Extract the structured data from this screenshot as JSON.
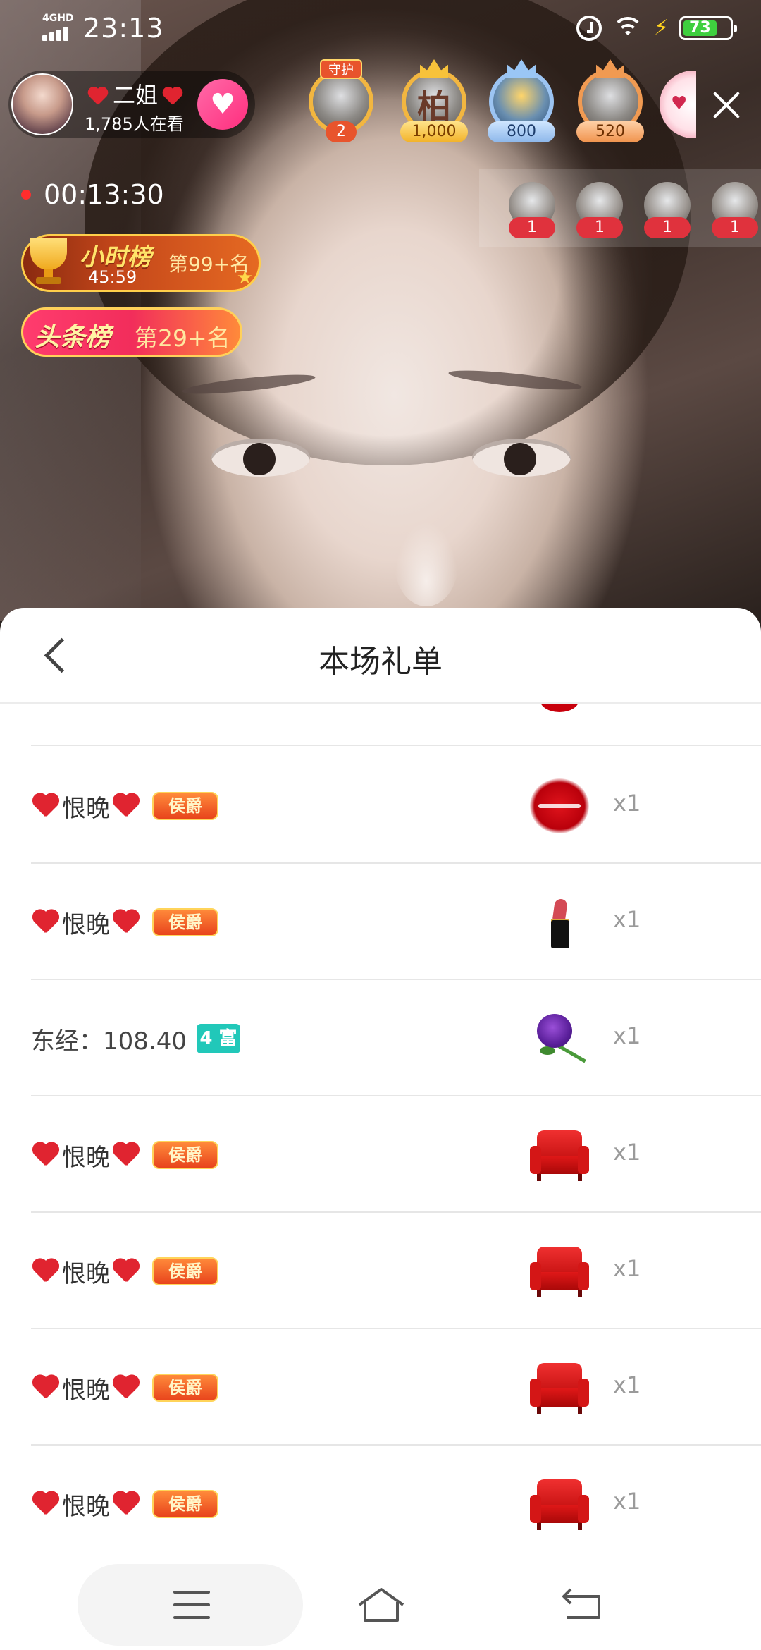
{
  "status_bar": {
    "network": "4GHD",
    "time": "23:13",
    "battery": "73",
    "icons": [
      "signal-icon",
      "alarm-icon",
      "wifi-icon",
      "charging-icon",
      "battery-icon"
    ]
  },
  "host": {
    "name": "二姐",
    "viewers": "1,785人在看"
  },
  "fan_badges": [
    {
      "tag": "守护",
      "value": "2",
      "style": "guard"
    },
    {
      "char": "柏",
      "value": "1,000",
      "style": "gold"
    },
    {
      "value": "800",
      "style": "silver"
    },
    {
      "value": "520",
      "style": "bronze"
    }
  ],
  "live": {
    "elapsed": "00:13:30"
  },
  "viewer_avatars": [
    {
      "count": "1"
    },
    {
      "count": "1"
    },
    {
      "count": "1"
    },
    {
      "count": "1"
    }
  ],
  "rank_hour": {
    "title": "小时榜",
    "countdown": "45:59",
    "rank": "第99+名"
  },
  "rank_headline": {
    "title": "头条榜",
    "rank": "第29+名"
  },
  "sheet": {
    "title": "本场礼单"
  },
  "gift_rows": [
    {
      "user": "恨晚",
      "badge": "侯爵",
      "gift_icon": "lips-icon",
      "qty": "x1"
    },
    {
      "user": "恨晚",
      "badge": "侯爵",
      "gift_icon": "lipstick-icon",
      "qty": "x1"
    },
    {
      "user": "东经：108.40",
      "wealth": "4 富",
      "gift_icon": "rose-icon",
      "qty": "x1"
    },
    {
      "user": "恨晚",
      "badge": "侯爵",
      "gift_icon": "sofa-icon",
      "qty": "x1"
    },
    {
      "user": "恨晚",
      "badge": "侯爵",
      "gift_icon": "sofa-icon",
      "qty": "x1"
    },
    {
      "user": "恨晚",
      "badge": "侯爵",
      "gift_icon": "sofa-icon",
      "qty": "x1"
    },
    {
      "user": "恨晚",
      "badge": "侯爵",
      "gift_icon": "sofa-icon",
      "qty": "x1"
    }
  ],
  "colors": {
    "accent_red": "#e02430",
    "badge_orange": "#e8441c",
    "wealth_teal": "#21c8b9",
    "follow_pink": "#ff2e7e"
  }
}
